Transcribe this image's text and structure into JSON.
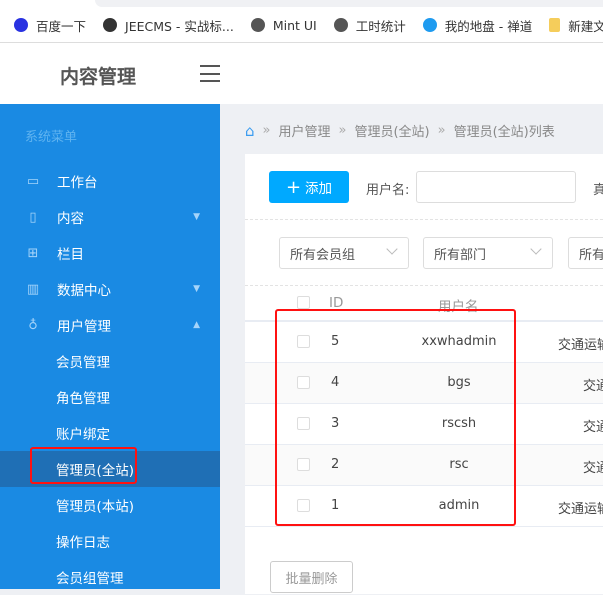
{
  "bookmarks": [
    {
      "label": "百度一下",
      "icon": "baidu-paw-icon",
      "color": "#2932e1"
    },
    {
      "label": "JEECMS - 实战标...",
      "icon": "jeecms-icon",
      "color": "#333333"
    },
    {
      "label": "Mint UI",
      "icon": "globe-icon",
      "color": "#555555"
    },
    {
      "label": "工时统计",
      "icon": "globe-icon",
      "color": "#555555"
    },
    {
      "label": "我的地盘 - 禅道",
      "icon": "zentao-icon",
      "color": "#1e9bf0"
    },
    {
      "label": "新建文件夹",
      "icon": "folder-icon",
      "color": "#f5cd5b"
    }
  ],
  "header": {
    "title": "内容管理"
  },
  "sidebar": {
    "title": "系统菜单",
    "items": [
      {
        "label": "工作台",
        "icon": "monitor-icon"
      },
      {
        "label": "内容",
        "icon": "file-icon"
      },
      {
        "label": "栏目",
        "icon": "grid-icon"
      },
      {
        "label": "数据中心",
        "icon": "bar-chart-icon"
      },
      {
        "label": "用户管理",
        "icon": "user-icon"
      }
    ],
    "subitems": [
      "会员管理",
      "角色管理",
      "账户绑定",
      "管理员(全站)",
      "管理员(本站)",
      "操作日志",
      "会员组管理"
    ]
  },
  "breadcrumb": [
    "用户管理",
    "管理员(全站)",
    "管理员(全站)列表"
  ],
  "toolbar": {
    "add_label": "添加",
    "username_label": "用户名:",
    "username_value": "",
    "next_label": "真"
  },
  "filters": [
    "所有会员组",
    "所有部门",
    "所有"
  ],
  "table": {
    "headers": [
      "ID",
      "用户名"
    ],
    "rows": [
      {
        "id": "5",
        "username": "xxwhadmin",
        "dept": "交通运输"
      },
      {
        "id": "4",
        "username": "bgs",
        "dept": "交通"
      },
      {
        "id": "3",
        "username": "rscsh",
        "dept": "交通"
      },
      {
        "id": "2",
        "username": "rsc",
        "dept": "交通"
      },
      {
        "id": "1",
        "username": "admin",
        "dept": "交通运输"
      }
    ]
  },
  "batch_delete_label": "批量删除",
  "colors": {
    "sidebar": "#1a8ae3",
    "active": "#1f6fb5",
    "primary": "#00a9ff",
    "highlight": "#ff1111"
  }
}
